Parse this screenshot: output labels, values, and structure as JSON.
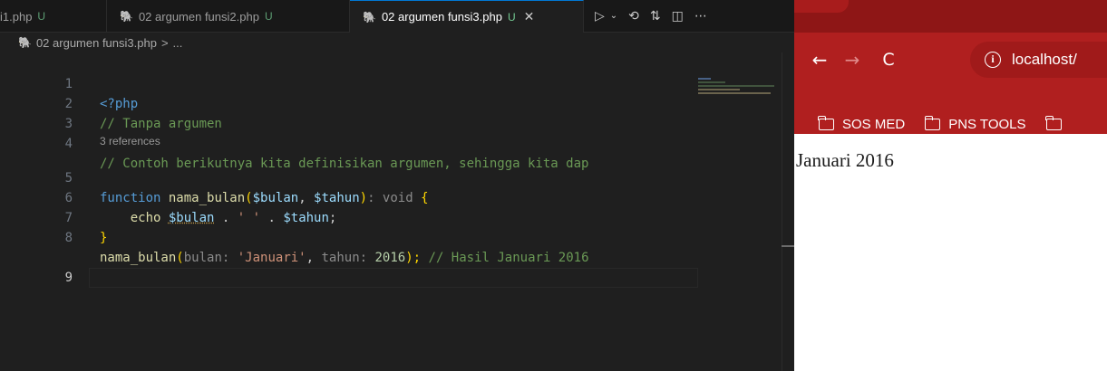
{
  "editor": {
    "tabs": [
      {
        "label": "i1.php",
        "status": "U"
      },
      {
        "label": "02 argumen funsi2.php",
        "status": "U"
      },
      {
        "label": "02 argumen funsi3.php",
        "status": "U",
        "active": true
      }
    ],
    "tab_close_glyph": "✕",
    "breadcrumb": {
      "file": "02 argumen funsi3.php",
      "separator": ">",
      "symbol": "..."
    },
    "references_lens": "3 references",
    "lines": [
      {
        "n": "1"
      },
      {
        "n": "2"
      },
      {
        "n": "3"
      },
      {
        "n": "4"
      },
      {
        "n": "5"
      },
      {
        "n": "6"
      },
      {
        "n": "7"
      },
      {
        "n": "8"
      },
      {
        "n": "9"
      }
    ],
    "code": {
      "l1_open": "<?php",
      "l2_comment": "// Tanpa argumen",
      "l4_comment": "// Contoh berikutnya kita definisikan argumen, sehingga kita dap",
      "l5_kw": "function",
      "l5_fn": "nama_bulan",
      "l5_open": "(",
      "l5_p1": "$bulan",
      "l5_comma": ", ",
      "l5_p2": "$tahun",
      "l5_close": ")",
      "l5_ret": ": void",
      "l5_brace": "{",
      "l6_echo": "echo",
      "l6_v1": "$bulan",
      "l6_dot1": " . ",
      "l6_str": "' '",
      "l6_dot2": " . ",
      "l6_v2": "$tahun",
      "l6_semi": ";",
      "l7_brace": "}",
      "l8_fn": "nama_bulan",
      "l8_open": "(",
      "l8_hint1": "bulan:",
      "l8_arg1": "'Januari'",
      "l8_comma": ",",
      "l8_hint2": "tahun:",
      "l8_arg2": "2016",
      "l8_close": ");",
      "l8_comment": "// Hasil Januari 2016"
    },
    "icons": {
      "php": "elephant-icon",
      "run": "run-icon",
      "history": "timeline-icon",
      "compare": "compare-changes-icon",
      "split": "split-editor-icon",
      "more": "more-actions-icon"
    }
  },
  "browser": {
    "url": "localhost/",
    "back_glyph": "←",
    "forward_glyph": "→",
    "reload_glyph": "C",
    "bookmarks": [
      "SOS MED",
      "PNS TOOLS"
    ],
    "content": "Januari 2016",
    "colors": {
      "chrome": "#b01f1f",
      "tabstrip": "#8e1616"
    }
  }
}
